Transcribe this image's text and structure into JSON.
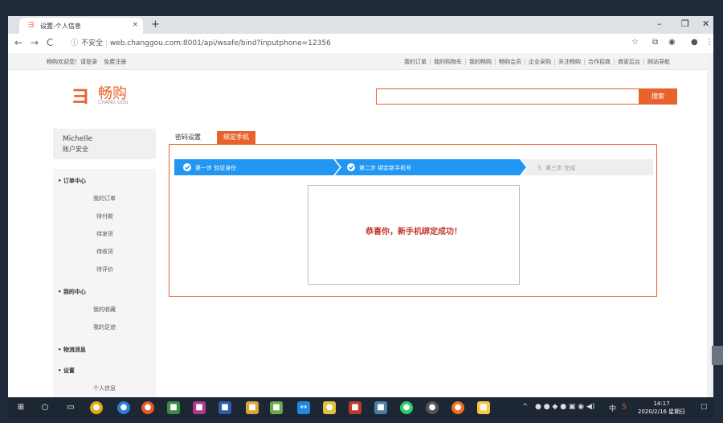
{
  "browser": {
    "tab_title": "设置-个人信息",
    "new_tab": "+",
    "close_tab": "×",
    "url_security": "不安全",
    "url": "web.changgou.com:8001/api/wsafe/bind?inputphone=12356",
    "window_controls": {
      "minimize": "–",
      "maximize": "❐",
      "close": "✕"
    }
  },
  "topbar": {
    "welcome": "畅购欢迎您！请登录",
    "register": "免费注册",
    "links": [
      "我的订单",
      "我的购物车",
      "我的畅购",
      "畅购会员",
      "企业采购",
      "关注畅购",
      "合作招商",
      "商家后台",
      "网站导航"
    ]
  },
  "logo": {
    "cn": "畅购",
    "en": "CHANG GOU",
    "mark": "ヨ"
  },
  "search": {
    "value": "",
    "button": "搜索"
  },
  "sidebar": {
    "user_name": "Michelle",
    "user_security": "账户安全",
    "sections": [
      {
        "header": "订单中心",
        "items": [
          "我的订单",
          "待付款",
          "待发货",
          "待收货",
          "待评价"
        ]
      },
      {
        "header": "我的中心",
        "items": [
          "我的收藏",
          "我的足迹"
        ]
      },
      {
        "header": "物流消息",
        "items": []
      },
      {
        "header": "设置",
        "items": [
          "个人信息"
        ]
      }
    ]
  },
  "tabs": {
    "inactive": "密码设置",
    "active": "绑定手机"
  },
  "steps": [
    {
      "label": "第一步 验证身份",
      "status": "done"
    },
    {
      "label": "第二步 绑定新手机号",
      "status": "done"
    },
    {
      "num": "3",
      "label": "第三步 完成",
      "status": "todo"
    }
  ],
  "message": "恭喜你，新手机绑定成功！",
  "taskbar": {
    "time": "14:17",
    "date": "2020/2/16 星期日",
    "ime": "中"
  },
  "colors": {
    "accent": "#e8632c",
    "step_active": "#2196f3",
    "step_todo": "#eeeeee"
  }
}
